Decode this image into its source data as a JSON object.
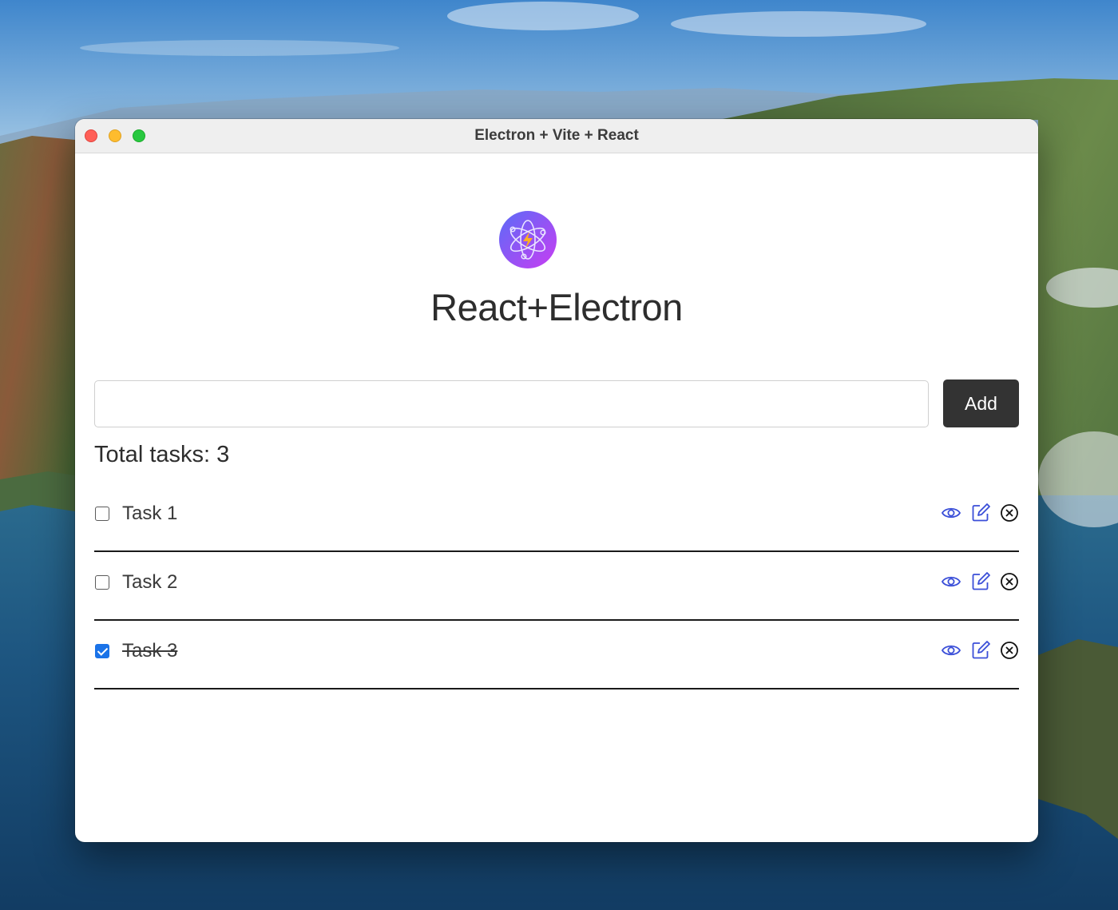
{
  "window": {
    "title": "Electron + Vite + React"
  },
  "app": {
    "logo_icon": "electron-vite-logo-icon",
    "heading": "React+Electron"
  },
  "task_form": {
    "input_value": "",
    "add_label": "Add"
  },
  "summary": {
    "total_text": "Total tasks: 3"
  },
  "tasks": [
    {
      "label": "Task 1",
      "completed": false
    },
    {
      "label": "Task 2",
      "completed": false
    },
    {
      "label": "Task 3",
      "completed": true
    }
  ],
  "icons": {
    "view": "eye-icon",
    "edit": "edit-icon",
    "delete": "delete-circle-icon"
  },
  "colors": {
    "accent": "#1a73e8",
    "action_icon": "#3b4fd8",
    "button_bg": "#333333",
    "logo_gradient_start": "#5b6cf7",
    "logo_gradient_end": "#c83df2"
  }
}
